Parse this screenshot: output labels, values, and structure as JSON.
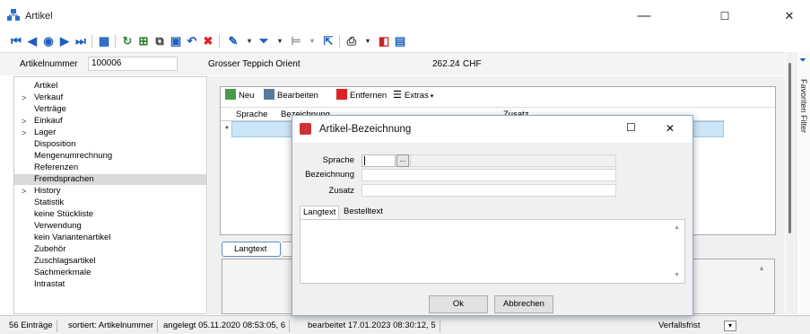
{
  "window": {
    "title": "Artikel",
    "min": "—",
    "max": "☐",
    "close": "✕"
  },
  "header": {
    "number_label": "Artikelnummer",
    "number_value": "100006",
    "name": "Grosser Teppich Orient",
    "price": "262.24",
    "currency": "CHF"
  },
  "nav": [
    {
      "label": "Artikel",
      "chev": ""
    },
    {
      "label": "Verkauf",
      "chev": ">"
    },
    {
      "label": "Verträge",
      "chev": ""
    },
    {
      "label": "Einkauf",
      "chev": ">"
    },
    {
      "label": "Lager",
      "chev": ">"
    },
    {
      "label": "Disposition",
      "chev": ""
    },
    {
      "label": "Mengenumrechnung",
      "chev": ""
    },
    {
      "label": "Referenzen",
      "chev": ""
    },
    {
      "label": "Fremdsprachen",
      "chev": "",
      "selected": true
    },
    {
      "label": "History",
      "chev": ">"
    },
    {
      "label": "Statistik",
      "chev": ""
    },
    {
      "label": "keine Stückliste",
      "chev": ""
    },
    {
      "label": "Verwendung",
      "chev": ""
    },
    {
      "label": "kein Variantenartikel",
      "chev": ""
    },
    {
      "label": "Zubehör",
      "chev": ""
    },
    {
      "label": "Zuschlagsartikel",
      "chev": ""
    },
    {
      "label": "Sachmerkmale",
      "chev": ""
    },
    {
      "label": "Intrastat",
      "chev": ""
    }
  ],
  "grid": {
    "new": "Neu",
    "edit": "Bearbeiten",
    "delete": "Entfernen",
    "extras": "Extras",
    "col_sprache": "Sprache",
    "col_bezeichnung": "Bezeichnung",
    "col_zusatz": "Zusatz",
    "row_marker": "*"
  },
  "tabs": {
    "langtext": "Langtext"
  },
  "favorites": {
    "label": "Favoriten Filter"
  },
  "status": {
    "entries": "56 Einträge",
    "sort": "sortiert: Artikelnummer",
    "created": "angelegt 05.11.2020 08:53:05, 6",
    "edited": "bearbeitet 17.01.2023 08:30:12, 5",
    "expiry": "Verfallsfrist"
  },
  "dialog": {
    "title": "Artikel-Bezeichnung",
    "sprache": "Sprache",
    "bezeichnung": "Bezeichnung",
    "zusatz": "Zusatz",
    "browse": "...",
    "tab_langtext": "Langtext",
    "tab_bestelltext": "Bestelltext",
    "ok": "Ok",
    "cancel": "Abbrechen"
  },
  "icons": [
    "app-icon",
    "first-record-icon",
    "prev-record-icon",
    "prev-icon",
    "next-icon",
    "last-record-icon",
    "list-view-icon",
    "refresh-icon",
    "new-record-icon",
    "copy-icon",
    "save-icon",
    "undo-icon",
    "delete-icon",
    "pin-icon",
    "filter-icon",
    "tree-icon",
    "cursor-icon",
    "print-icon",
    "pdf-icon",
    "disk-icon"
  ],
  "colors": {
    "accent": "#1e5fbf",
    "selection": "#cde6f7",
    "delete_red": "#d22"
  }
}
